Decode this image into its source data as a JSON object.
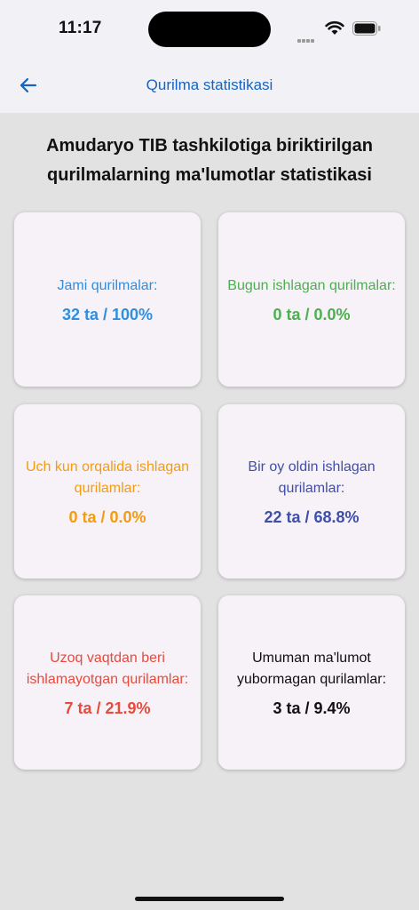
{
  "status": {
    "time": "11:17"
  },
  "app_bar": {
    "title": "Qurilma statistikasi"
  },
  "heading": "Amudaryo TIB tashkilotiga biriktirilgan qurilmalarning ma'lumotlar statistikasi",
  "cards": [
    {
      "label": "Jami qurilmalar:",
      "value": "32 ta / 100%",
      "color": "#2e8ee0"
    },
    {
      "label": "Bugun ishlagan qurilmalar:",
      "value": "0 ta / 0.0%",
      "color": "#4caf50"
    },
    {
      "label": "Uch kun orqalida ishlagan qurilamlar:",
      "value": "0 ta / 0.0%",
      "color": "#f39c12"
    },
    {
      "label": "Bir oy oldin  ishlagan qurilamlar:",
      "value": "22 ta / 68.8%",
      "color": "#3f4fa8"
    },
    {
      "label": "Uzoq vaqtdan beri ishlamayotgan qurilamlar:",
      "value": "7 ta / 21.9%",
      "color": "#e84a3c"
    },
    {
      "label": "Umuman ma'lumot yubormagan qurilamlar:",
      "value": "3 ta / 9.4%",
      "color": "#111111"
    }
  ],
  "icons": {
    "back": "arrow-left-icon",
    "wifi": "wifi-icon",
    "battery": "battery-icon",
    "signal": "cellular-signal-icon"
  }
}
